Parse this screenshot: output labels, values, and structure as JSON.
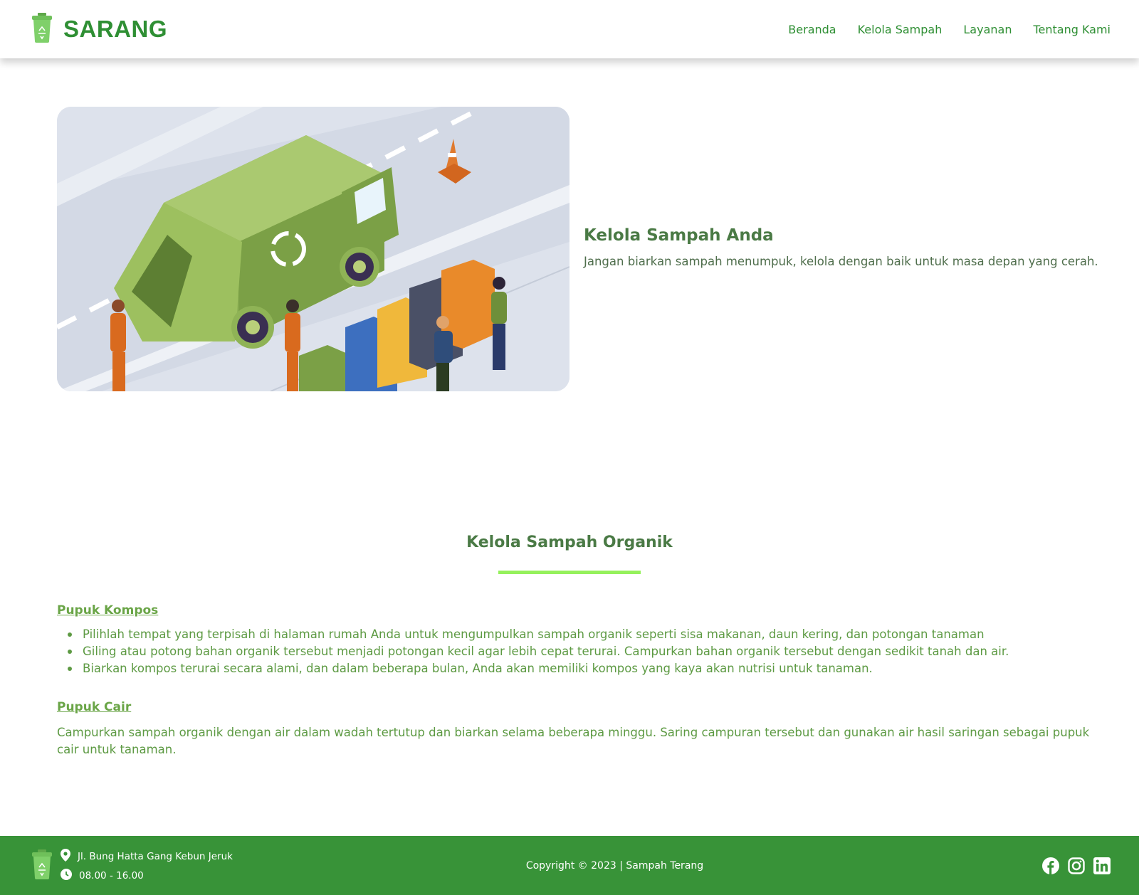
{
  "header": {
    "brand": "SARANG",
    "nav": [
      "Beranda",
      "Kelola Sampah",
      "Layanan",
      "Tentang Kami"
    ]
  },
  "hero": {
    "title": "Kelola Sampah Anda",
    "subtitle": "Jangan biarkan sampah menumpuk, kelola dengan baik untuk masa depan yang cerah."
  },
  "section": {
    "title": "Kelola Sampah Organik",
    "kompos": {
      "heading": "Pupuk Kompos",
      "steps": [
        "Pilihlah tempat yang terpisah di halaman rumah Anda untuk mengumpulkan sampah organik seperti sisa makanan, daun kering, dan potongan tanaman",
        "Giling atau potong bahan organik tersebut menjadi potongan kecil agar lebih cepat terurai. Campurkan bahan organik tersebut dengan sedikit tanah dan air.",
        "Biarkan kompos terurai secara alami, dan dalam beberapa bulan, Anda akan memiliki kompos yang kaya akan nutrisi untuk tanaman."
      ]
    },
    "cair": {
      "heading": "Pupuk Cair",
      "text": "Campurkan sampah organik dengan air dalam wadah tertutup dan biarkan selama beberapa minggu. Saring campuran tersebut dan gunakan air hasil saringan sebagai pupuk cair untuk tanaman."
    }
  },
  "footer": {
    "address": "Jl. Bung Hatta Gang Kebun Jeruk",
    "hours": "08.00 - 16.00",
    "copyright": "Copyright © 2023 | Sampah Terang",
    "social_icons": [
      "facebook-icon",
      "instagram-icon",
      "linkedin-icon"
    ]
  },
  "colors": {
    "brand_green": "#2f8f34",
    "footer_green": "#389338",
    "accent_bar": "#95f15c"
  }
}
